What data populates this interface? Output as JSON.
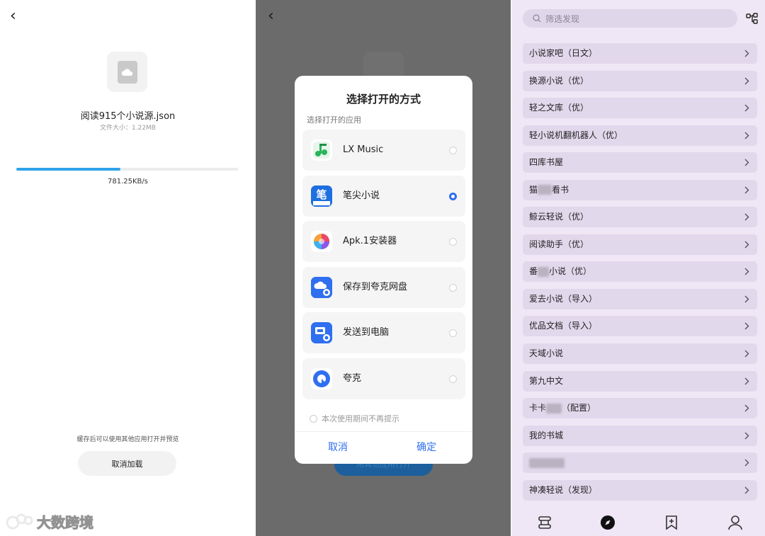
{
  "panel1": {
    "file_name": "阅读915个小说源.json",
    "file_size": "文件大小：1.22MB",
    "progress": 0.47,
    "speed": "781.25KB/s",
    "hint": "缓存后可以使用其他应用打开并预览",
    "cancel_button": "取消加载",
    "watermark": "大数跨境"
  },
  "panel2": {
    "background_button": "用其他应用打开",
    "dialog": {
      "title": "选择打开的方式",
      "subtitle": "选择打开的应用",
      "apps": [
        {
          "label": "LX Music",
          "icon": "lx-music-icon",
          "selected": false
        },
        {
          "label": "笔尖小说",
          "icon": "bijian-novel-icon",
          "selected": true
        },
        {
          "label": "Apk.1安装器",
          "icon": "apk-installer-icon",
          "selected": false
        },
        {
          "label": "保存到夸克网盘",
          "icon": "quark-cloud-icon",
          "selected": false
        },
        {
          "label": "发送到电脑",
          "icon": "send-to-pc-icon",
          "selected": false
        },
        {
          "label": "夸克",
          "icon": "quark-icon",
          "selected": false
        }
      ],
      "dont_remind": "本次使用期间不再提示",
      "cancel": "取消",
      "confirm": "确定"
    }
  },
  "panel3": {
    "search_placeholder": "筛选发现",
    "sources": [
      {
        "parts": [
          "小说家吧（日文）"
        ]
      },
      {
        "parts": [
          "换源小说（优）"
        ]
      },
      {
        "parts": [
          "轻之文库（优）"
        ]
      },
      {
        "parts": [
          "轻小说机翻机器人（优）"
        ]
      },
      {
        "parts": [
          "四库书屋"
        ]
      },
      {
        "parts": [
          "猫",
          "看书"
        ],
        "blur_width": 20
      },
      {
        "parts": [
          "鲸云轻说（优）"
        ]
      },
      {
        "parts": [
          "阅读助手（优）"
        ]
      },
      {
        "parts": [
          "番",
          "小说（优）"
        ],
        "blur_width": 16
      },
      {
        "parts": [
          "爱去小说（导入）"
        ]
      },
      {
        "parts": [
          "优品文档（导入）"
        ]
      },
      {
        "parts": [
          "天域小说"
        ]
      },
      {
        "parts": [
          "第九中文"
        ]
      },
      {
        "parts": [
          "卡卡",
          "（配置）"
        ],
        "blur_width": 22
      },
      {
        "parts": [
          "我的书城"
        ]
      },
      {
        "parts": [
          "",
          ""
        ],
        "blur_width": 50
      },
      {
        "parts": [
          "神凑轻说（发现）"
        ]
      }
    ],
    "nav": [
      "bookshelf-icon",
      "discover-icon",
      "bookmark-icon",
      "profile-icon"
    ]
  }
}
